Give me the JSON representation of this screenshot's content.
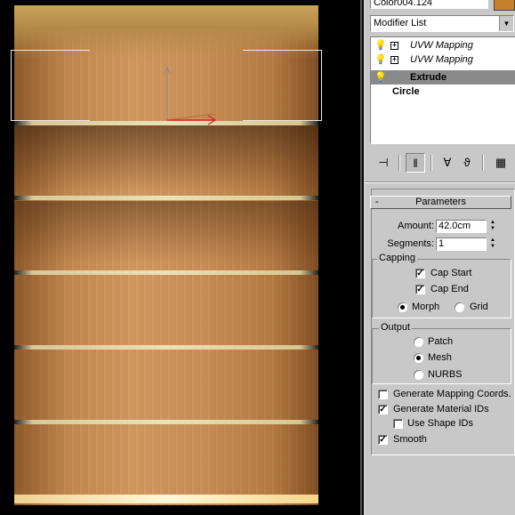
{
  "panel": {
    "color_field": "Color004.124",
    "color_swatch": "#c7802a",
    "modifier_list": "Modifier List",
    "stack": [
      {
        "label": "UVW Mapping"
      },
      {
        "label": "UVW Mapping"
      },
      {
        "label": "Extrude"
      },
      {
        "label": "Circle"
      }
    ],
    "toolbar": {
      "pin": "pin-stack-icon",
      "show_end": "show-end-result-icon",
      "unique": "make-unique-icon",
      "remove": "remove-modifier-icon",
      "config": "configure-sets-icon"
    },
    "parameters": {
      "title": "Parameters",
      "collapse": "-",
      "amount_label": "Amount:",
      "amount_value": "42.0cm",
      "segments_label": "Segments:",
      "segments_value": "1",
      "capping_title": "Capping",
      "cap_start": "Cap Start",
      "cap_start_checked": true,
      "cap_end": "Cap End",
      "cap_end_checked": true,
      "morph": "Morph",
      "grid": "Grid",
      "capping_selected": "Morph",
      "output_title": "Output",
      "patch": "Patch",
      "mesh": "Mesh",
      "nurbs": "NURBS",
      "output_selected": "Mesh",
      "gen_mapping": "Generate Mapping Coords.",
      "gen_mapping_checked": false,
      "gen_mat_ids": "Generate Material IDs",
      "gen_mat_ids_checked": true,
      "use_shape_ids": "Use Shape IDs",
      "use_shape_ids_checked": false,
      "smooth": "Smooth",
      "smooth_checked": true
    }
  }
}
